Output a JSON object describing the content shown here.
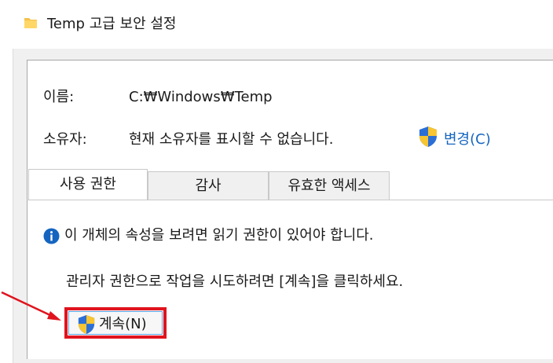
{
  "window": {
    "title": "Temp 고급 보안 설정"
  },
  "fields": {
    "name_label": "이름:",
    "name_value": "C:₩Windows₩Temp",
    "owner_label": "소유자:",
    "owner_value": "현재 소유자를 표시할 수 없습니다.",
    "change_link": "변경(C)"
  },
  "tabs": [
    {
      "label": "사용 권한",
      "active": true
    },
    {
      "label": "감사",
      "active": false
    },
    {
      "label": "유효한 액세스",
      "active": false
    }
  ],
  "messages": {
    "info": "이 개체의 속성을 보려면 읽기 권한이 있어야 합니다.",
    "instruction": "관리자 권한으로 작업을 시도하려면 [계속]을 클릭하세요."
  },
  "buttons": {
    "continue_label": "계속(N)"
  },
  "colors": {
    "accent_link": "#1565c0",
    "highlight_box": "#e0141e",
    "arrow": "#e0141e",
    "info_icon": "#1565c0"
  },
  "icons": [
    "folder-icon",
    "uac-shield-icon",
    "info-icon"
  ]
}
